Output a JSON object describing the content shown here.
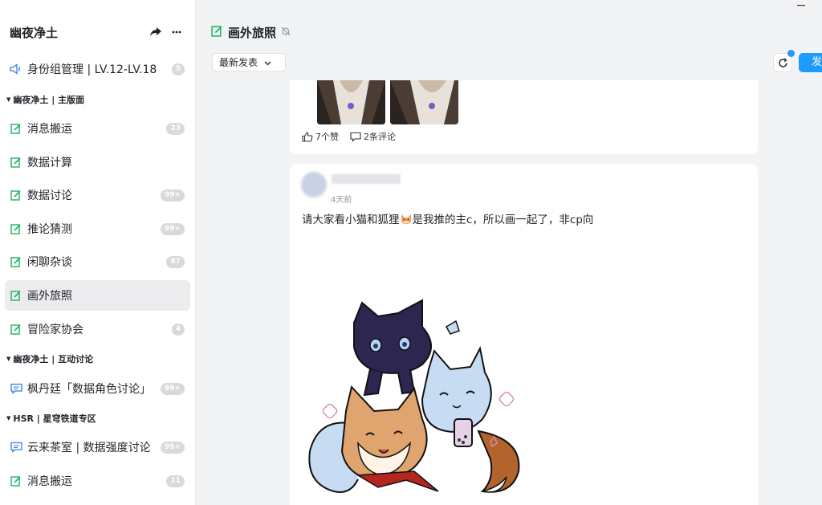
{
  "server": {
    "name": "幽夜净土"
  },
  "sidebar": {
    "top_channel": {
      "label": "身份组管理 | LV.12-LV.18",
      "badge": "5"
    },
    "groups": [
      {
        "title": "幽夜净土 | 主版面"
      },
      {
        "title": "幽夜净土 | 互动讨论"
      },
      {
        "title": "HSR | 星穹铁道专区"
      }
    ],
    "items": [
      {
        "label": "消息搬运",
        "badge": "23"
      },
      {
        "label": "数据计算",
        "badge": ""
      },
      {
        "label": "数据讨论",
        "badge": "99+"
      },
      {
        "label": "推论猜测",
        "badge": "99+"
      },
      {
        "label": "闲聊杂谈",
        "badge": "87"
      },
      {
        "label": "画外旅照",
        "badge": ""
      },
      {
        "label": "冒险家协会",
        "badge": "4"
      },
      {
        "label": "枫丹廷「数据角色讨论」",
        "badge": "99+"
      },
      {
        "label": "云来茶室 | 数据强度讨论",
        "badge": "99+"
      },
      {
        "label": "消息搬运",
        "badge": "11"
      }
    ]
  },
  "channel": {
    "title": "画外旅照",
    "sort_label": "最新发表",
    "post_button": "发"
  },
  "posts": [
    {
      "likes": "7个赞",
      "comments": "2条评论"
    },
    {
      "time": "4天前",
      "text_before": "请大家看小猫和狐狸",
      "text_after": "是我推的主c，所以画一起了，非cp向"
    }
  ],
  "colors": {
    "accent": "#1e9bff",
    "channel_icon": "#19b35e",
    "active_bg": "#ececee"
  }
}
